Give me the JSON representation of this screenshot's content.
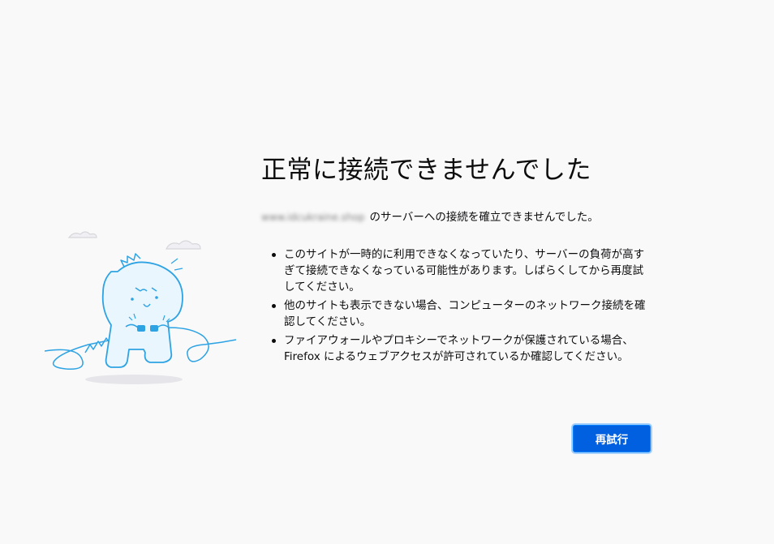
{
  "error_page": {
    "title": "正常に接続できませんでした",
    "host": "www.idcukraine.shop",
    "description_suffix": "のサーバーへの接続を確立できませんでした。",
    "reasons": [
      "このサイトが一時的に利用できなくなっていたり、サーバーの負荷が高すぎて接続できなくなっている可能性があります。しばらくしてから再度試してください。",
      "他のサイトも表示できない場合、コンピューターのネットワーク接続を確認してください。",
      "ファイアウォールやプロキシーでネットワークが保護されている場合、Firefox によるウェブアクセスが許可されているか確認してください。"
    ],
    "retry_label": "再試行",
    "illustration": "unplugged-dinosaur-illustration"
  },
  "colors": {
    "background": "#f9f9fa",
    "text": "#0c0c0d",
    "button": "#0060df",
    "illustration_stroke": "#2ea3e3",
    "illustration_fill": "#eaf6fd"
  }
}
